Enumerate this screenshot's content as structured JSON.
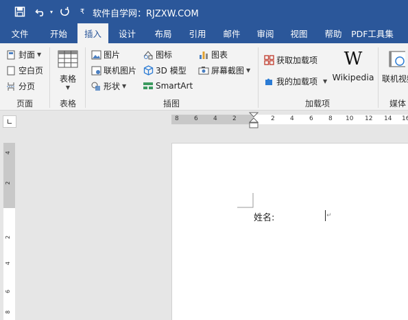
{
  "window": {
    "title": "软件自学网：RJZXW.COM"
  },
  "quick_access": {
    "save_icon": "save-icon",
    "undo_icon": "undo-icon",
    "redo_icon": "redo-icon",
    "customize_icon": "customize-icon"
  },
  "tabs": [
    {
      "label": "文件"
    },
    {
      "label": "开始"
    },
    {
      "label": "插入",
      "active": true
    },
    {
      "label": "设计"
    },
    {
      "label": "布局"
    },
    {
      "label": "引用"
    },
    {
      "label": "邮件"
    },
    {
      "label": "审阅"
    },
    {
      "label": "视图"
    },
    {
      "label": "帮助"
    },
    {
      "label": "PDF工具集"
    }
  ],
  "ribbon": {
    "pages": {
      "label": "页面",
      "cover": "封面",
      "blank": "空白页",
      "break": "分页"
    },
    "tables": {
      "label": "表格",
      "table": "表格"
    },
    "illustrations": {
      "label": "插图",
      "picture": "图片",
      "icons": "图标",
      "chart": "图表",
      "online_picture": "联机图片",
      "model3d": "3D 模型",
      "screenshot": "屏幕截图",
      "shapes": "形状",
      "smartart": "SmartArt"
    },
    "addins": {
      "label": "加载项",
      "get": "获取加载项",
      "my": "我的加载项",
      "wikipedia": "Wikipedia"
    },
    "media": {
      "label": "媒体",
      "online_video": "联机视频"
    }
  },
  "ruler": {
    "horizontal_ticks": [
      "8",
      "6",
      "4",
      "2",
      "2",
      "4",
      "6",
      "8",
      "10",
      "12",
      "14",
      "16"
    ],
    "vertical_ticks": [
      "4",
      "2",
      "2",
      "4",
      "6",
      "8"
    ]
  },
  "document": {
    "line1": "姓名:"
  },
  "colors": {
    "brand": "#2b579a",
    "ribbon_bg": "#f3f3f3",
    "canvas": "#e6e6e6"
  }
}
